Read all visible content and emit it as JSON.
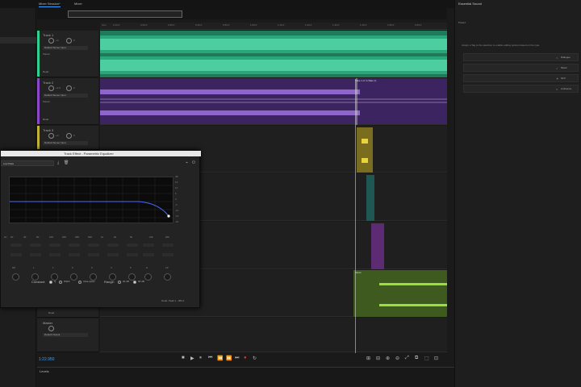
{
  "tabs": [
    "Mixer Session*",
    "Mixer"
  ],
  "right_panel": {
    "title": "Essential Sound",
    "preset_label": "Preset:",
    "message": "Assign a Tag to the selection to enable editing options based on the type.",
    "buttons": [
      {
        "label": "Dialogue",
        "icon": "mic-icon"
      },
      {
        "label": "Music",
        "icon": "music-icon"
      },
      {
        "label": "SFX",
        "icon": "sfx-icon"
      },
      {
        "label": "Ambience",
        "icon": "ambience-icon"
      }
    ]
  },
  "ruler": [
    "hms",
    "0:10.0",
    "0:20.0",
    "0:30.0",
    "0:40.0",
    "0:50.0",
    "1:00.0",
    "1:10.0",
    "1:20.0",
    "1:30.0",
    "1:40.0",
    "1:50.0",
    "2:00.0"
  ],
  "tracks": [
    {
      "name": "Track 1",
      "volume": "+0",
      "pan": "0",
      "input": "Default Stereo Input",
      "mode": "Master",
      "read": "Read",
      "color": "#2ecf8f"
    },
    {
      "name": "Track 2",
      "volume": "+1.0",
      "pan": "0",
      "input": "Default Stereo Input",
      "mode": "Master",
      "read": "Read",
      "color": "#8a48c9"
    },
    {
      "name": "Track 3",
      "volume": "+0",
      "pan": "0",
      "input": "Default Stereo Input",
      "mode": "Master",
      "read": "Read",
      "color": "#c2b23a"
    }
  ],
  "lane_clips": {
    "track2_label": "Take 1 of 4 (Take 1)",
    "track6_label": "Music"
  },
  "bottom_track": {
    "read": "Read",
    "name": "Master",
    "output": "Default Output"
  },
  "timecode": "1:22.950",
  "levels_label": "Levels",
  "effect": {
    "title": "Track Effect - Parametric Equalizer",
    "preset": "Low Pass",
    "db_scale": [
      "dB",
      "15",
      "10",
      "5",
      "0",
      "-5",
      "-10",
      "-15",
      "-20"
    ],
    "hz_scale": [
      "Hz",
      "20",
      "40",
      "60",
      "100",
      "200",
      "300",
      "500",
      "1k",
      "2k",
      "5k",
      "10k",
      "20k"
    ],
    "band_labels": [
      "HP",
      "L",
      "1",
      "2",
      "3",
      "4",
      "5",
      "H",
      "LP"
    ],
    "constant_label": "Constant:",
    "radio": [
      {
        "label": "Q",
        "checked": true
      },
      {
        "label": "Width",
        "checked": false
      },
      {
        "label": "Ultra-Quiet",
        "checked": false
      }
    ],
    "range_label": "Range:",
    "range": [
      {
        "label": "30 dB",
        "checked": false
      },
      {
        "label": "96 dB",
        "checked": true
      }
    ],
    "footer": "Node: Peak 1 - 384.1"
  },
  "colors": {
    "accent": "#3aa0ff",
    "green": "#2ecf8f",
    "purple": "#8a48c9",
    "yellow": "#c2b23a",
    "teal": "#2a8a88",
    "olive": "#6f8a2e"
  }
}
